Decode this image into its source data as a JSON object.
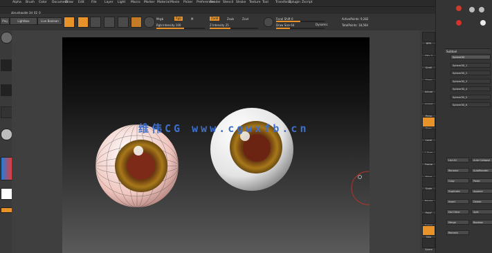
{
  "menu": [
    "Alpha",
    "Brush",
    "Color",
    "Document",
    "Draw",
    "Edit",
    "File",
    "Layer",
    "Light",
    "Macro",
    "Marker",
    "Material",
    "Movie",
    "Picker",
    "Preferences",
    "Render",
    "Stencil",
    "Stroke",
    "Texture",
    "Tool",
    "Transform",
    "Zplugin",
    "Zscript"
  ],
  "title": "zbrushguide 3d_02_0",
  "toolbar": {
    "left_tabs": [
      "Proj",
      "Lightbox",
      "Live Boolean"
    ],
    "labels": [
      "Edit",
      "Draw",
      "Move",
      "Scale",
      "Rotate"
    ],
    "mrgb": "Mrgb",
    "rgb": "Rgb",
    "m": "M",
    "rgb_intensity": "Rgb Intensity 100",
    "zadd": "Zadd",
    "zsub": "Zsub",
    "zcut": "Zcut",
    "z_intensity": "Z Intensity 25",
    "focal_shift": "Focal Shift 0",
    "draw_size": "Draw Size 64",
    "dynamic": "Dynamic",
    "active_points": "ActivePoints: 9,282",
    "total_points": "TotalPoints: 18,564"
  },
  "watermark": "维伟CG www.cgwxfb.cn",
  "right_shelf": [
    "BPR",
    "SPix 3",
    "Scroll",
    "Zoom",
    "Actual",
    "AAHalf",
    "Persp",
    "Floor",
    "Local",
    "L.Sym",
    "Frame",
    "Move",
    "Scale",
    "Rotate",
    "PolyF",
    "Transp",
    "Solo",
    "Xpose"
  ],
  "tool_panel": {
    "header": "Subtool",
    "items": [
      "Sphere3D",
      "Sphere3D_1",
      "Sphere3D_2",
      "Sphere3D_3",
      "Sphere3D_4",
      "Sphere3D_5",
      "Sphere3D_6"
    ],
    "buttons": [
      "List All",
      "Auto Collapse",
      "Rename",
      "AutoReorder",
      "Copy",
      "Paste",
      "Duplicate",
      "Append",
      "Insert",
      "Delete",
      "Del Other",
      "Split",
      "Merge",
      "Boolean",
      "Remesh"
    ]
  },
  "colors": {
    "accent": "#e8932a",
    "panel": "#343434",
    "viewport": "#1b1b1b"
  }
}
